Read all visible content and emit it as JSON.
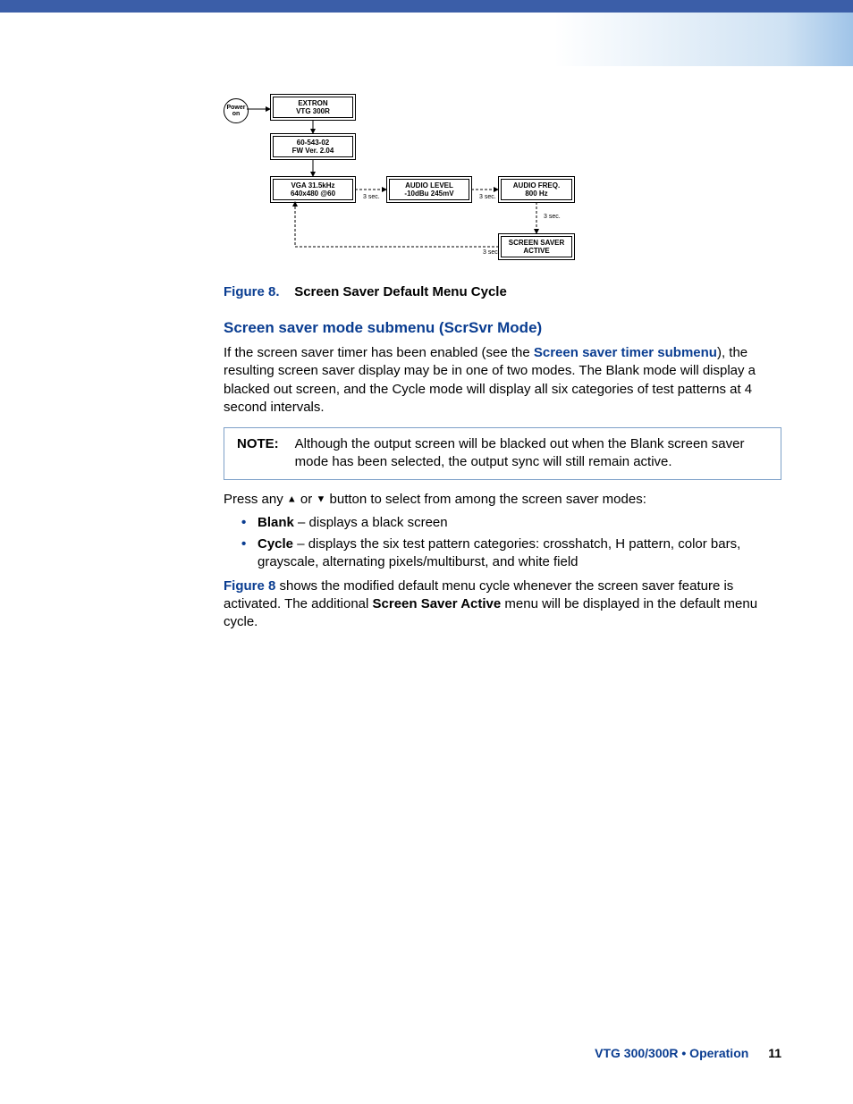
{
  "diagram": {
    "power": "Power on",
    "box_extron_l1": "EXTRON",
    "box_extron_l2": "VTG    300R",
    "box_fw_l1": "60-543-02",
    "box_fw_l2": "FW  Ver. 2.04",
    "box_vga_l1": "VGA   31.5kHz",
    "box_vga_l2": "640x480 @60",
    "box_audioLvl_l1": "AUDIO LEVEL",
    "box_audioLvl_l2": "-10dBu  245mV",
    "box_audioFreq_l1": "AUDIO FREQ.",
    "box_audioFreq_l2": "800 Hz",
    "box_ss_l1": "SCREEN SAVER",
    "box_ss_l2": "ACTIVE",
    "sec1": "3 sec.",
    "sec2": "3 sec.",
    "sec3": "3 sec.",
    "sec4": "3 sec."
  },
  "figure": {
    "label": "Figure 8.",
    "caption": "Screen Saver Default Menu Cycle"
  },
  "section_heading": "Screen saver mode submenu (ScrSvr Mode)",
  "para1_a": "If the screen saver timer has been enabled (see the ",
  "para1_link": "Screen saver timer submenu",
  "para1_b": "), the resulting screen saver display may be in one of two modes. The Blank mode will display a blacked out screen, and the Cycle mode will display all six categories of test patterns at 4 second intervals.",
  "note": {
    "label": "NOTE:",
    "text": "Although the output screen will be blacked out when the Blank screen saver mode has been selected, the output sync will still remain active."
  },
  "para2_a": "Press any ",
  "para2_b": " or ",
  "para2_c": " button to select from among the screen saver modes:",
  "arrow_up": "▲",
  "arrow_down": "▼",
  "opts": {
    "blank_label": "Blank",
    "blank_text": " – displays a black screen",
    "cycle_label": "Cycle",
    "cycle_text": " – displays the six test pattern categories: crosshatch, H pattern, color bars, grayscale, alternating pixels/multiburst, and white field"
  },
  "para3_link": "Figure 8",
  "para3_a": " shows the modified default menu cycle whenever the screen saver feature is activated. The additional ",
  "para3_bold": "Screen Saver Active",
  "para3_b": " menu will be displayed in the default menu cycle.",
  "footer": {
    "title": "VTG 300/300R • Operation",
    "page": "11"
  }
}
